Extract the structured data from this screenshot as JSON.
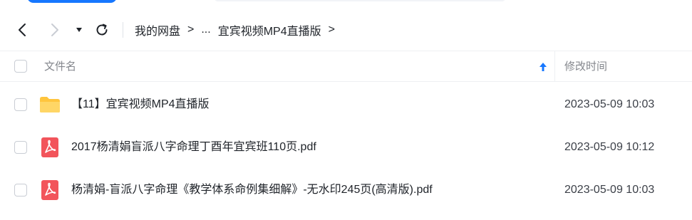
{
  "toolbar": {
    "breadcrumb": [
      "我的网盘",
      "...",
      "宜宾视频MP4直播版"
    ],
    "separator": ">"
  },
  "table": {
    "columns": {
      "name": "文件名",
      "modified": "修改时间"
    },
    "sort_direction": "ascending",
    "rows": [
      {
        "type": "folder",
        "icon": "folder-icon",
        "name": "【11】宜宾视频MP4直播版",
        "modified": "2023-05-09 10:03"
      },
      {
        "type": "pdf",
        "icon": "pdf-icon",
        "name": "2017杨清娟盲派八字命理丁酉年宜宾班110页.pdf",
        "modified": "2023-05-09 10:12"
      },
      {
        "type": "pdf",
        "icon": "pdf-icon",
        "name": "杨清娟-盲派八字命理《教学体系命例集细解》-无水印245页(高清版).pdf",
        "modified": "2023-05-09 10:03"
      }
    ]
  },
  "colors": {
    "accent": "#1677ff",
    "folder": "#ffc53d",
    "pdf": "#f2545b",
    "muted_text": "#84878d"
  }
}
